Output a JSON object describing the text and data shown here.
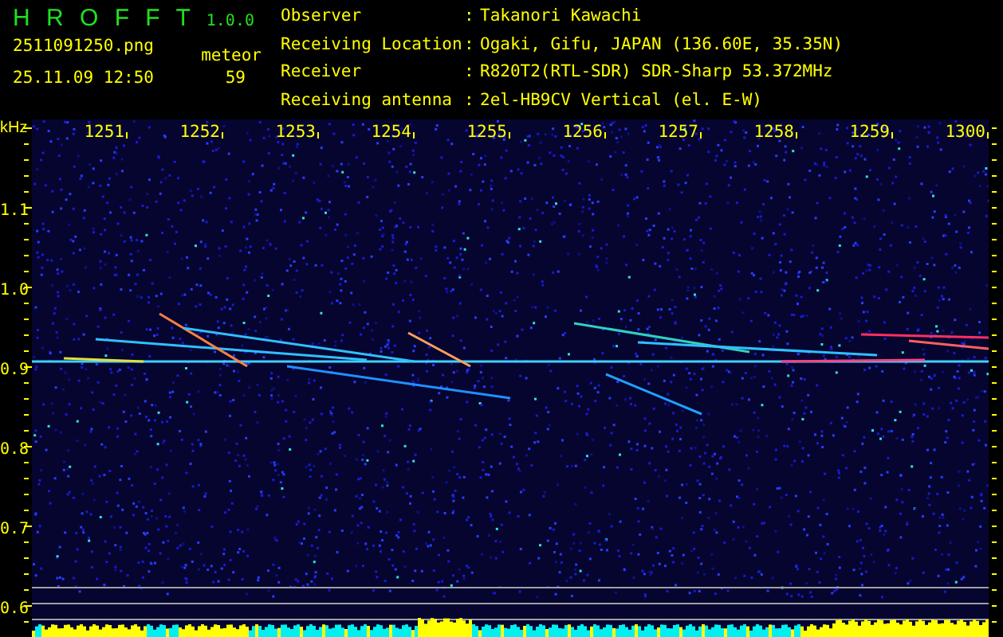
{
  "app": {
    "name": "H R O F F T",
    "version": "1.0.0"
  },
  "file": {
    "name": "2511091250.png",
    "datetime": "25.11.09 12:50"
  },
  "count": {
    "label": "meteor",
    "value": "59"
  },
  "station": [
    {
      "label": "Observer",
      "sep": ":",
      "value": "Takanori Kawachi"
    },
    {
      "label": "Receiving Location",
      "sep": ":",
      "value": "Ogaki, Gifu, JAPAN (136.60E, 35.35N)"
    },
    {
      "label": "Receiver",
      "sep": ":",
      "value": "R820T2(RTL-SDR) SDR-Sharp 53.372MHz"
    },
    {
      "label": "Receiving antenna",
      "sep": ":",
      "value": "2el-HB9CV Vertical (el. E-W)"
    }
  ],
  "spectrogram": {
    "y_unit": "kHz",
    "y_labels": [
      "1.1",
      "1.0",
      "0.9",
      "0.8",
      "0.7",
      "0.6"
    ],
    "x_labels": [
      "1251",
      "1252",
      "1253",
      "1254",
      "1255",
      "1256",
      "1257",
      "1258",
      "1259",
      "1300"
    ]
  }
}
